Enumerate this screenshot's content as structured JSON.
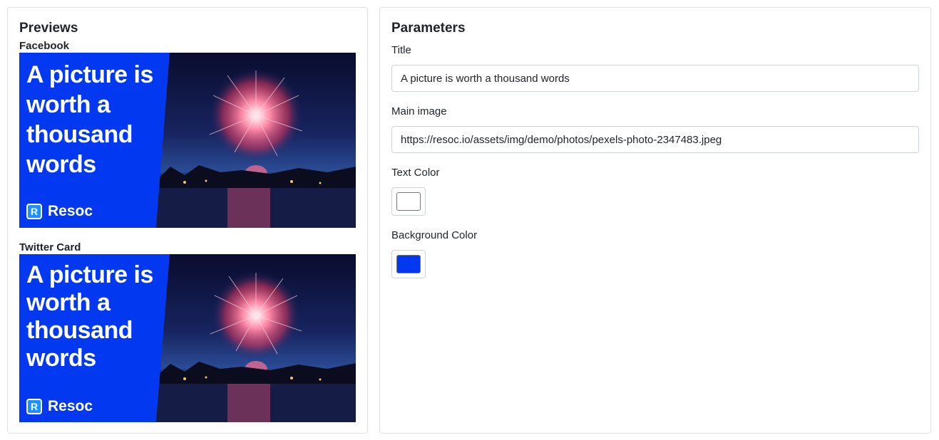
{
  "previews": {
    "title": "Previews",
    "facebook": {
      "label": "Facebook",
      "headline": "A picture is worth a thousand words",
      "brand": "Resoc",
      "logo_letter": "R"
    },
    "twitter": {
      "label": "Twitter Card",
      "headline": "A picture is worth a thousand words",
      "brand": "Resoc",
      "logo_letter": "R"
    }
  },
  "parameters": {
    "title": "Parameters",
    "title_field": {
      "label": "Title",
      "value": "A picture is worth a thousand words"
    },
    "main_image_field": {
      "label": "Main image",
      "value": "https://resoc.io/assets/img/demo/photos/pexels-photo-2347483.jpeg"
    },
    "text_color_field": {
      "label": "Text Color",
      "value": "#ffffff"
    },
    "background_color_field": {
      "label": "Background Color",
      "value": "#0338f1"
    }
  },
  "colors": {
    "brand_background": "#0338f1",
    "text": "#ffffff",
    "border": "#dee2e6"
  },
  "icons": {
    "logo": "resoc-logo-icon",
    "photo": "fireworks-photo"
  }
}
